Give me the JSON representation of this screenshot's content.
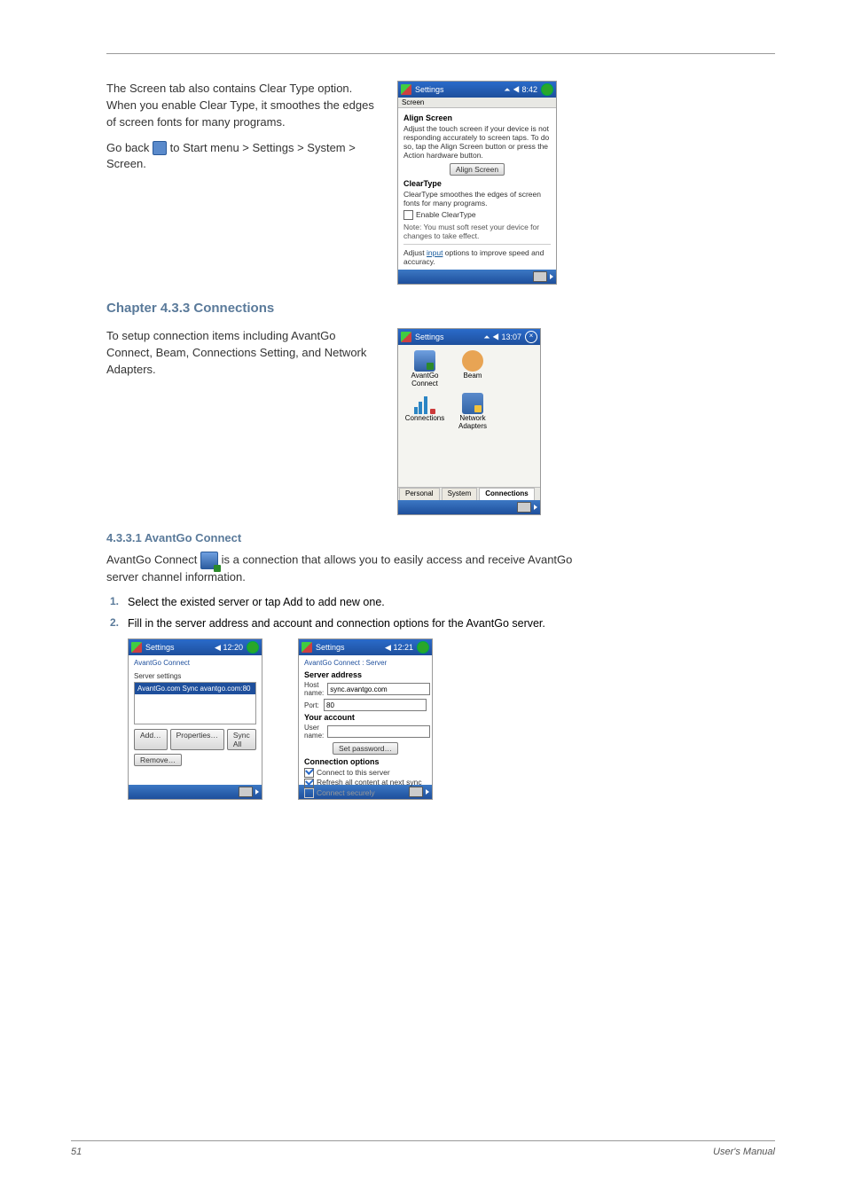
{
  "chapter": {
    "heading": "Chapter 4.3.3 Connections"
  },
  "section1": {
    "para": "The Screen tab also contains Clear Type option. When you enable Clear Type, it smoothes the edges of screen fonts for many programs. ",
    "icon_note_prefix": "Go back ",
    "icon_note_suffix": " to Start menu > Settings > System > Screen."
  },
  "screen_shot": {
    "title": "Settings",
    "time": "⏶ ◀ 8:42",
    "heading": "Screen",
    "sect1": "Align Screen",
    "p1": "Adjust the touch screen if your device is not responding accurately to screen taps. To do so, tap the Align Screen button or press the Action hardware button.",
    "btn": "Align Screen",
    "sect2": "ClearType",
    "p2": "ClearType smoothes the edges of screen fonts for many programs.",
    "cb": "Enable ClearType",
    "note": "Note: You must soft reset your device for changes to take effect.",
    "p3_a": "Adjust ",
    "p3_link": "input",
    "p3_b": " options to improve speed and accuracy."
  },
  "section2": {
    "para": "To setup connection items including AvantGo Connect, Beam, Connections Setting, and Network Adapters."
  },
  "conn_shot": {
    "title": "Settings",
    "time": "⏶ ◀ 13:07",
    "items": [
      "AvantGo Connect",
      "Beam",
      "Connections",
      "Network Adapters"
    ],
    "tabs": [
      "Personal",
      "System",
      "Connections"
    ],
    "sel_tab": "Connections"
  },
  "section3": {
    "title": "4.3.3.1 AvantGo Connect",
    "intro": "AvantGo Connect ",
    "intro2": " is a connection that allows you to easily access and receive AvantGo server channel information.",
    "step1": "Select the existed server or tap Add to add new one.",
    "step2": "Fill in the server address and account and connection options for the AvantGo server."
  },
  "ag_shot1": {
    "title": "Settings",
    "time": "◀ 12:20",
    "header": "AvantGo Connect",
    "sub": "Server settings",
    "selected": "AvantGo.com Sync avantgo.com:80",
    "btn_add": "Add…",
    "btn_prop": "Properties…",
    "btn_sync": "Sync All",
    "btn_rem": "Remove…"
  },
  "ag_shot2": {
    "title": "Settings",
    "time": "◀ 12:21",
    "header": "AvantGo Connect : Server",
    "s1": "Server address",
    "host_l": "Host name:",
    "host_v": "sync.avantgo.com",
    "port_l": "Port:",
    "port_v": "80",
    "s2": "Your account",
    "user_l": "User name:",
    "btn_pwd": "Set password…",
    "s3": "Connection options",
    "cb1": "Connect to this server",
    "cb2": "Refresh all content at next sync",
    "cb3": "Connect securely"
  },
  "footer": {
    "left": "51",
    "right": "User's Manual"
  }
}
